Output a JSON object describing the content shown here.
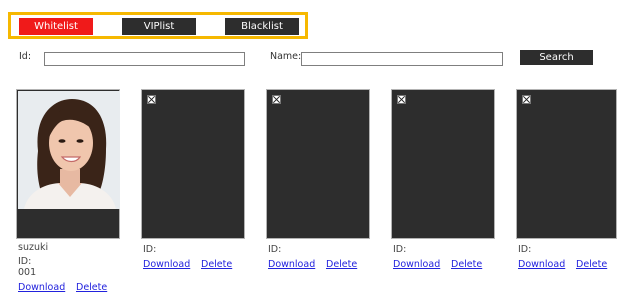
{
  "tabs": [
    {
      "label": "Whitelist",
      "active": true
    },
    {
      "label": "VIPlist",
      "active": false
    },
    {
      "label": "Blacklist",
      "active": false
    }
  ],
  "search": {
    "id_label": "Id:",
    "id_value": "",
    "name_label": "Name:",
    "name_value": "",
    "button_label": "Search"
  },
  "cards": [
    {
      "name": "suzuki",
      "id_label": "ID:",
      "id_value": "001",
      "download_label": "Download",
      "delete_label": "Delete",
      "has_photo": true
    },
    {
      "name": "",
      "id_label": "ID:",
      "id_value": "",
      "download_label": "Download",
      "delete_label": "Delete",
      "has_photo": false
    },
    {
      "name": "",
      "id_label": "ID:",
      "id_value": "",
      "download_label": "Download",
      "delete_label": "Delete",
      "has_photo": false
    },
    {
      "name": "",
      "id_label": "ID:",
      "id_value": "",
      "download_label": "Download",
      "delete_label": "Delete",
      "has_photo": false
    },
    {
      "name": "",
      "id_label": "ID:",
      "id_value": "",
      "download_label": "Download",
      "delete_label": "Delete",
      "has_photo": false
    }
  ],
  "colors": {
    "active_tab": "#f01a1a",
    "tab_bg": "#2d2d2d",
    "highlight_frame": "#f6b800",
    "link": "#2222dd"
  }
}
